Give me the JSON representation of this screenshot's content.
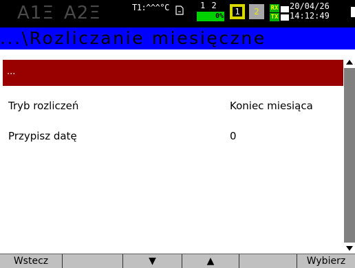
{
  "status": {
    "alarm1": "A1Ξ",
    "alarm2": "A2Ξ",
    "temperature": "T1:^^^°C",
    "sd_icon": "sd-card-icon",
    "channels": "1 2",
    "buffer_percent": "0%",
    "channel1": "1",
    "channel2": "2",
    "rx_label": "RX",
    "tx_label": "TX",
    "date": "20/04/26",
    "time": "14:12:49"
  },
  "title": "...\\Rozliczanie miesięczne",
  "menu": {
    "selected_label": "...",
    "items": [
      {
        "label": "Tryb rozliczeń",
        "value": "Koniec miesiąca"
      },
      {
        "label": "Przypisz datę",
        "value": "0"
      }
    ]
  },
  "scrollbar": {
    "up_icon": "up-arrow-icon",
    "down_icon": "down-arrow-icon"
  },
  "softkeys": [
    {
      "label": "Wstecz"
    },
    {
      "label": ""
    },
    {
      "label": "▼"
    },
    {
      "label": "▲"
    },
    {
      "label": ""
    },
    {
      "label": "Wybierz"
    }
  ],
  "colors": {
    "status_bg": "#000000",
    "title_bg": "#0000ff",
    "selected_row": "#990000",
    "softkey_bg": "#c0c0c0",
    "scrollbar": "#808080"
  }
}
